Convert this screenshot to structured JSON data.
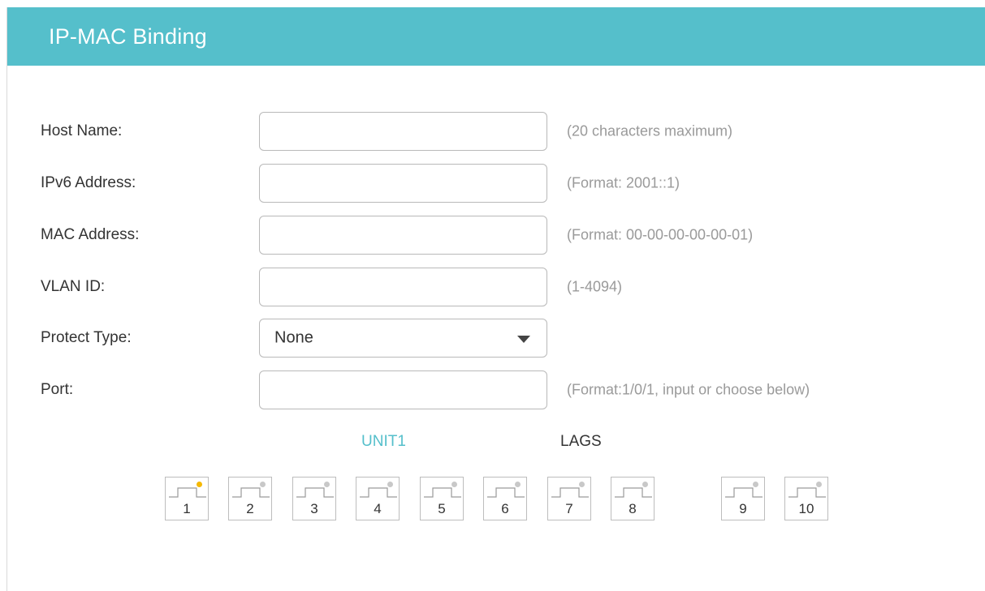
{
  "header": {
    "title": "IP-MAC Binding"
  },
  "form": {
    "host_name": {
      "label": "Host Name:",
      "value": "",
      "hint": "(20 characters maximum)"
    },
    "ipv6_address": {
      "label": "IPv6 Address:",
      "value": "",
      "hint": "(Format: 2001::1)"
    },
    "mac_address": {
      "label": "MAC Address:",
      "value": "",
      "hint": "(Format: 00-00-00-00-00-01)"
    },
    "vlan_id": {
      "label": "VLAN ID:",
      "value": "",
      "hint": "(1-4094)"
    },
    "protect_type": {
      "label": "Protect Type:",
      "selected": "None",
      "icon": "caret-down-icon"
    },
    "port": {
      "label": "Port:",
      "value": "",
      "hint": "(Format:1/0/1, input or choose below)"
    }
  },
  "port_tabs": {
    "unit": "UNIT1",
    "lags": "LAGS",
    "active": "UNIT1"
  },
  "ports": [
    {
      "number": "1",
      "status": "active"
    },
    {
      "number": "2",
      "status": "inactive"
    },
    {
      "number": "3",
      "status": "inactive"
    },
    {
      "number": "4",
      "status": "inactive"
    },
    {
      "number": "5",
      "status": "inactive"
    },
    {
      "number": "6",
      "status": "inactive"
    },
    {
      "number": "7",
      "status": "inactive"
    },
    {
      "number": "8",
      "status": "inactive"
    },
    {
      "number": "9",
      "status": "inactive"
    },
    {
      "number": "10",
      "status": "inactive"
    }
  ],
  "colors": {
    "header_bg": "#55bfcb",
    "active_tab": "#55bfcb",
    "led_active": "#f5b800",
    "led_inactive": "#c8c8c8"
  }
}
